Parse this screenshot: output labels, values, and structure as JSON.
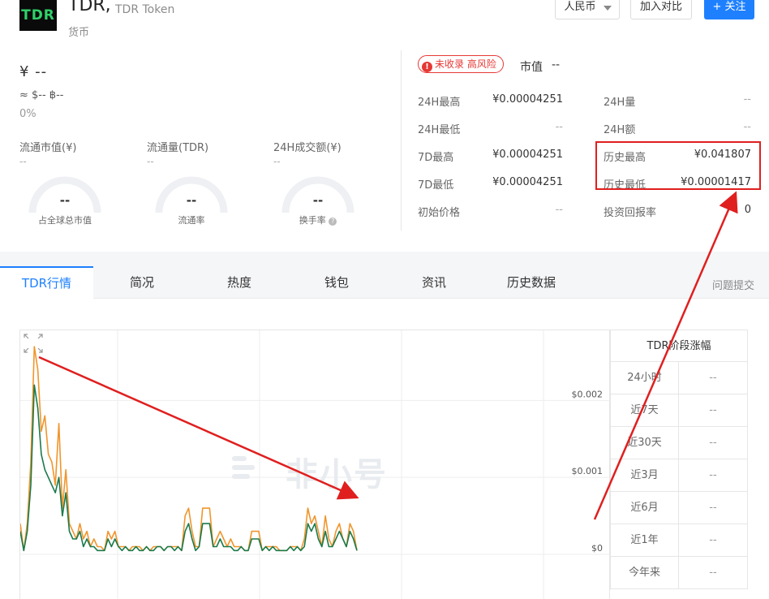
{
  "header": {
    "logo_text": "TDR",
    "symbol": "TDR,",
    "name": "TDR Token",
    "type": "货币",
    "currency_button": "人民币",
    "compare_button": "加入对比",
    "follow_button": "+ 关注"
  },
  "summary": {
    "price": "¥ --",
    "approx": "≈ $--  ฿--",
    "change": "0%",
    "stats": [
      {
        "label": "流通市值(¥)",
        "value": "--"
      },
      {
        "label": "流通量(TDR)",
        "value": "--"
      },
      {
        "label": "24H成交额(¥)",
        "value": "--"
      }
    ],
    "gauges": [
      {
        "value": "--",
        "label": "占全球总市值"
      },
      {
        "value": "--",
        "label": "流通率"
      },
      {
        "value": "--",
        "label": "换手率",
        "has_help": true
      }
    ]
  },
  "risk_badge": "未收录 高风险",
  "market_cap": {
    "label": "市值",
    "value": "--"
  },
  "metrics_left": [
    {
      "label": "24H最高",
      "value": "¥0.00004251"
    },
    {
      "label": "24H最低",
      "value": "--"
    },
    {
      "label": "7D最高",
      "value": "¥0.00004251"
    },
    {
      "label": "7D最低",
      "value": "¥0.00004251"
    },
    {
      "label": "初始价格",
      "value": "--"
    }
  ],
  "metrics_right": [
    {
      "label": "24H量",
      "value": "--"
    },
    {
      "label": "24H额",
      "value": "--"
    },
    {
      "label": "历史最高",
      "value": "¥0.041807"
    },
    {
      "label": "历史最低",
      "value": "¥0.00001417"
    },
    {
      "label": "投资回报率",
      "value": "0"
    }
  ],
  "tabs": [
    {
      "label": "TDR行情",
      "active": true
    },
    {
      "label": "简况",
      "active": false
    },
    {
      "label": "热度",
      "active": false
    },
    {
      "label": "钱包",
      "active": false
    },
    {
      "label": "资讯",
      "active": false
    },
    {
      "label": "历史数据",
      "active": false
    }
  ],
  "feedback": "问题提交",
  "chart": {
    "expand_icon": "expand-icon",
    "y_ticks": [
      "$0.002",
      "$0.001",
      "$0"
    ],
    "watermark": "非小号",
    "colors": {
      "orange": "#f0952d",
      "green": "#1b7a4b",
      "annotation": "#e01f1f"
    }
  },
  "chart_data": {
    "type": "line",
    "ylim": [
      0,
      0.0027
    ],
    "y_ticks": [
      "$0.002",
      "$0.001",
      "$0"
    ],
    "series": [
      {
        "values": [
          0.0004,
          5e-05,
          0.0004,
          0.0012,
          0.0027,
          0.0024,
          0.0016,
          0.0018,
          0.0013,
          0.0012,
          0.0009,
          0.0017,
          0.0006,
          0.0011,
          0.0004,
          0.0003,
          0.0002,
          0.0004,
          0.0002,
          0.0003,
          0.0001,
          0.0002,
          0.0001,
          0.0001,
          5e-05,
          0.0003,
          0.0002,
          0.0003,
          0.0001,
          0.0001,
          0.0001,
          5e-05,
          0.0001,
          0.0001,
          0.0001,
          5e-05,
          0.0001,
          5e-05,
          0.0001,
          0.0001,
          0.0001,
          5e-05,
          0.0001,
          0.0001,
          0.0001,
          0.0001,
          5e-05,
          0.0005,
          0.0006,
          0.0003,
          0.0001,
          0.0001,
          0.0006,
          0.0006,
          0.0006,
          0.0001,
          0.0002,
          0.0003,
          0.0002,
          0.0001,
          0.0002,
          0.0001,
          0.0001,
          0.0001,
          5e-05,
          5e-05,
          0.0003,
          0.0003,
          0.0003,
          5e-05,
          0.0001,
          0.0001,
          0.0001,
          0.0001,
          5e-05,
          5e-05,
          5e-05,
          0.0001,
          0.0001,
          0.0001,
          5e-05,
          0.0002,
          0.0006,
          0.0004,
          0.0005,
          0.0003,
          0.0001,
          0.0005,
          0.0002,
          0.0001,
          0.0003,
          0.0004,
          0.0002,
          0.0001,
          0.0004,
          0.0003,
          5e-05
        ]
      },
      {
        "values": [
          0.0003,
          5e-05,
          0.0003,
          0.0009,
          0.0022,
          0.0019,
          0.0013,
          0.0011,
          0.001,
          0.0009,
          0.0008,
          0.001,
          0.0005,
          0.0008,
          0.0003,
          0.0002,
          0.0002,
          0.0003,
          0.0001,
          0.0002,
          0.0001,
          0.0001,
          5e-05,
          5e-05,
          5e-05,
          0.0002,
          0.0001,
          0.0002,
          0.0001,
          5e-05,
          0.0001,
          5e-05,
          5e-05,
          0.0001,
          5e-05,
          5e-05,
          0.0001,
          5e-05,
          5e-05,
          0.0001,
          0.0001,
          5e-05,
          0.0001,
          0.0001,
          5e-05,
          0.0001,
          5e-05,
          0.0003,
          0.0004,
          0.0002,
          5e-05,
          0.0001,
          0.0004,
          0.0004,
          0.0004,
          0.0001,
          0.0001,
          0.0002,
          0.0001,
          0.0001,
          0.0001,
          5e-05,
          5e-05,
          0.0001,
          5e-05,
          5e-05,
          0.0002,
          0.0002,
          0.0002,
          5e-05,
          0.0001,
          5e-05,
          0.0001,
          5e-05,
          5e-05,
          5e-05,
          5e-05,
          0.0001,
          5e-05,
          0.0001,
          5e-05,
          0.0001,
          0.0004,
          0.0003,
          0.0004,
          0.0002,
          0.0001,
          0.0003,
          0.0001,
          0.0001,
          0.0002,
          0.0003,
          0.0002,
          0.0001,
          0.0003,
          0.0002,
          5e-05
        ]
      }
    ]
  },
  "performance": {
    "title": "TDR阶段涨幅",
    "rows": [
      {
        "label": "24小时",
        "value": "--"
      },
      {
        "label": "近7天",
        "value": "--"
      },
      {
        "label": "近30天",
        "value": "--"
      },
      {
        "label": "近3月",
        "value": "--"
      },
      {
        "label": "近6月",
        "value": "--"
      },
      {
        "label": "近1年",
        "value": "--"
      },
      {
        "label": "今年来",
        "value": "--"
      }
    ]
  }
}
